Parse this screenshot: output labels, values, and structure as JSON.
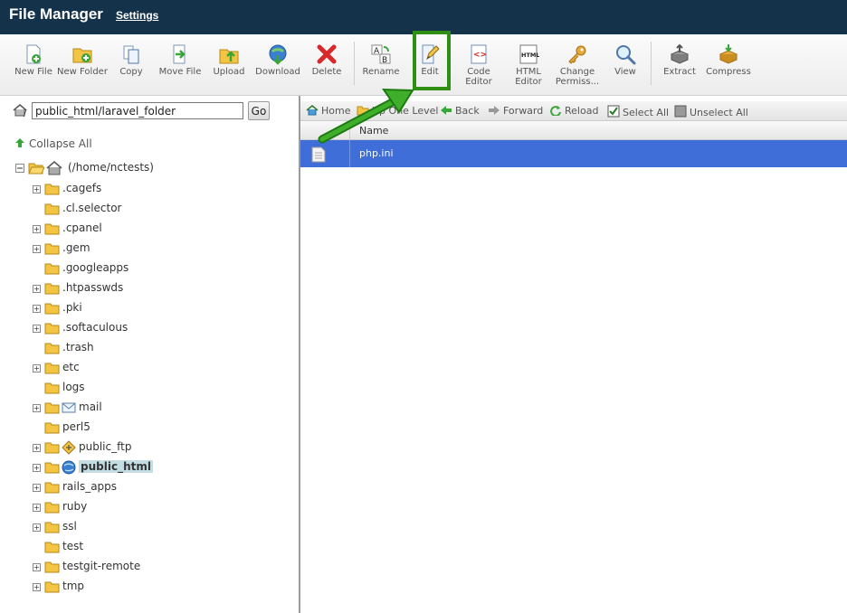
{
  "header": {
    "title": "File Manager",
    "settings_label": "Settings"
  },
  "toolbar": {
    "new_file": "New File",
    "new_folder": "New Folder",
    "copy": "Copy",
    "move_file": "Move File",
    "upload": "Upload",
    "download": "Download",
    "delete": "Delete",
    "rename": "Rename",
    "edit": "Edit",
    "code_editor": "Code Editor",
    "html_editor": "HTML Editor",
    "change_permissions": "Change Permiss...",
    "view": "View",
    "extract": "Extract",
    "compress": "Compress"
  },
  "path": {
    "value": "public_html/laravel_folder",
    "go_label": "Go"
  },
  "tree": {
    "collapse_all": "Collapse All",
    "root_label": "(/home/nctests)",
    "items": [
      {
        "label": ".cagefs",
        "expandable": true
      },
      {
        "label": ".cl.selector",
        "expandable": false
      },
      {
        "label": ".cpanel",
        "expandable": true
      },
      {
        "label": ".gem",
        "expandable": true
      },
      {
        "label": ".googleapps",
        "expandable": false
      },
      {
        "label": ".htpasswds",
        "expandable": true
      },
      {
        "label": ".pki",
        "expandable": true
      },
      {
        "label": ".softaculous",
        "expandable": true
      },
      {
        "label": ".trash",
        "expandable": false
      },
      {
        "label": "etc",
        "expandable": true
      },
      {
        "label": "logs",
        "expandable": false
      },
      {
        "label": "mail",
        "expandable": true
      },
      {
        "label": "perl5",
        "expandable": false
      },
      {
        "label": "public_ftp",
        "expandable": true
      },
      {
        "label": "public_html",
        "expandable": true
      },
      {
        "label": "rails_apps",
        "expandable": true
      },
      {
        "label": "ruby",
        "expandable": true
      },
      {
        "label": "ssl",
        "expandable": true
      },
      {
        "label": "test",
        "expandable": false
      },
      {
        "label": "testgit-remote",
        "expandable": true
      },
      {
        "label": "tmp",
        "expandable": true
      }
    ]
  },
  "nav": {
    "home": "Home",
    "up_one_level": "Up One Level",
    "back": "Back",
    "forward": "Forward",
    "reload": "Reload",
    "select_all": "Select All",
    "unselect_all": "Unselect All"
  },
  "filelist": {
    "column_name": "Name",
    "files": [
      {
        "name": "php.ini"
      }
    ]
  },
  "colors": {
    "header_bg": "#14334a",
    "selected_row": "#3f6ed8",
    "highlight": "#2f8f12"
  }
}
